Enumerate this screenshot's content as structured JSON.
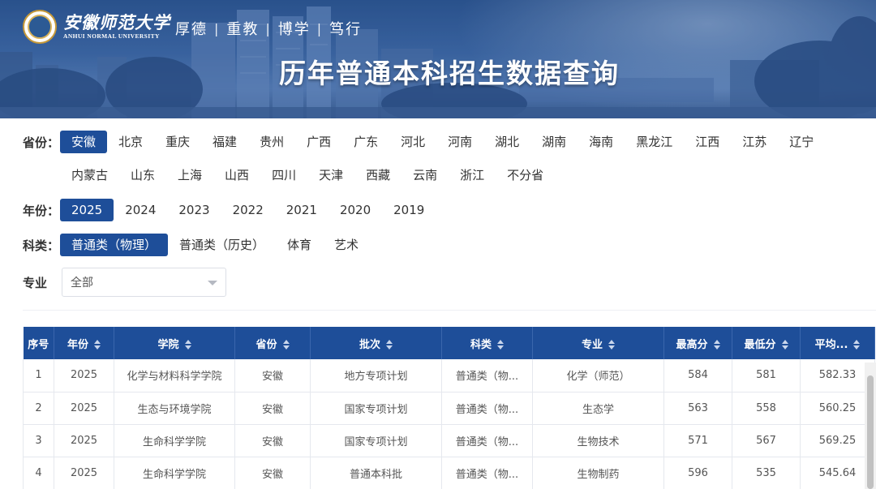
{
  "header": {
    "logo_cn": "安徽师范大学",
    "logo_en": "ANHUI NORMAL UNIVERSITY",
    "motto": [
      "厚德",
      "重教",
      "博学",
      "笃行"
    ],
    "motto_sep": "|",
    "title": "历年普通本科招生数据查询"
  },
  "filters": {
    "province": {
      "label": "省份：",
      "active": "安徽",
      "row1": [
        "安徽",
        "北京",
        "重庆",
        "福建",
        "贵州",
        "广西",
        "广东",
        "河北",
        "河南",
        "湖北",
        "湖南",
        "海南",
        "黑龙江",
        "江西",
        "江苏",
        "辽宁"
      ],
      "row2": [
        "内蒙古",
        "山东",
        "上海",
        "山西",
        "四川",
        "天津",
        "西藏",
        "云南",
        "浙江",
        "不分省"
      ]
    },
    "year": {
      "label": "年份：",
      "active": "2025",
      "options": [
        "2025",
        "2024",
        "2023",
        "2022",
        "2021",
        "2020",
        "2019"
      ]
    },
    "category": {
      "label": "科类：",
      "active": "普通类（物理）",
      "options": [
        "普通类（物理）",
        "普通类（历史）",
        "体育",
        "艺术"
      ]
    },
    "major": {
      "label": "专业",
      "selected": "全部"
    }
  },
  "table": {
    "columns": [
      {
        "label": "序号",
        "sortable": false
      },
      {
        "label": "年份",
        "sortable": true
      },
      {
        "label": "学院",
        "sortable": true
      },
      {
        "label": "省份",
        "sortable": true
      },
      {
        "label": "批次",
        "sortable": true
      },
      {
        "label": "科类",
        "sortable": true
      },
      {
        "label": "专业",
        "sortable": true
      },
      {
        "label": "最高分",
        "sortable": true
      },
      {
        "label": "最低分",
        "sortable": true
      },
      {
        "label": "平均...",
        "sortable": true
      }
    ],
    "rows": [
      [
        "1",
        "2025",
        "化学与材料科学学院",
        "安徽",
        "地方专项计划",
        "普通类（物...",
        "化学（师范）",
        "584",
        "581",
        "582.33"
      ],
      [
        "2",
        "2025",
        "生态与环境学院",
        "安徽",
        "国家专项计划",
        "普通类（物...",
        "生态学",
        "563",
        "558",
        "560.25"
      ],
      [
        "3",
        "2025",
        "生命科学学院",
        "安徽",
        "国家专项计划",
        "普通类（物...",
        "生物技术",
        "571",
        "567",
        "569.25"
      ],
      [
        "4",
        "2025",
        "生命科学学院",
        "安徽",
        "普通本科批",
        "普通类（物...",
        "生物制药",
        "596",
        "535",
        "545.64"
      ]
    ]
  },
  "colors": {
    "primary": "#1e4e99",
    "banner": "#3f6aa6"
  }
}
